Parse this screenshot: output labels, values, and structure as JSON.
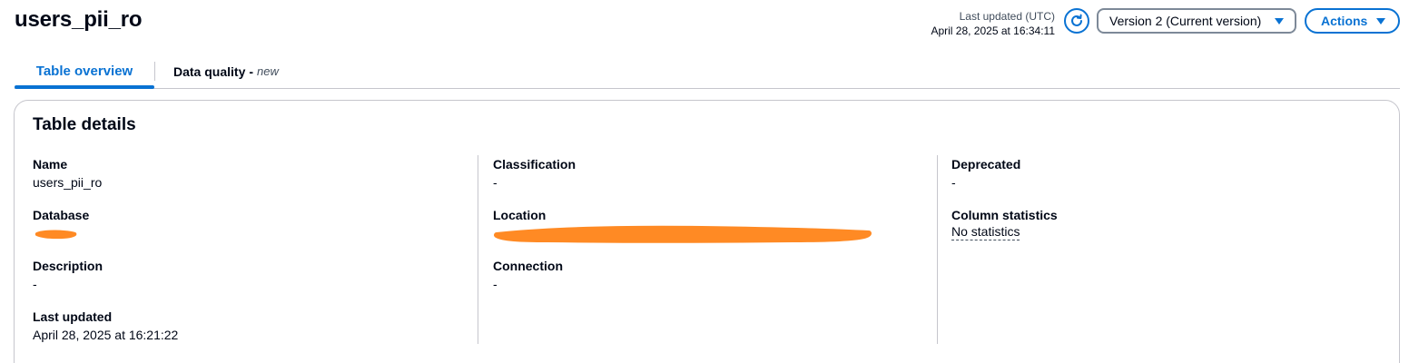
{
  "header": {
    "title": "users_pii_ro",
    "last_updated_label": "Last updated (UTC)",
    "last_updated_value": "April 28, 2025 at 16:34:11",
    "version_select": "Version 2 (Current version)",
    "actions_label": "Actions"
  },
  "tabs": [
    {
      "label": "Table overview",
      "active": true
    },
    {
      "label": "Data quality",
      "suffix": "new",
      "active": false
    }
  ],
  "tab_separator": "-",
  "details": {
    "title": "Table details",
    "name": {
      "label": "Name",
      "value": "users_pii_ro"
    },
    "database": {
      "label": "Database",
      "value": ""
    },
    "description": {
      "label": "Description",
      "value": "-"
    },
    "last_updated": {
      "label": "Last updated",
      "value": "April 28, 2025 at 16:21:22"
    },
    "classification": {
      "label": "Classification",
      "value": "-"
    },
    "location": {
      "label": "Location",
      "value": ""
    },
    "connection": {
      "label": "Connection",
      "value": "-"
    },
    "deprecated": {
      "label": "Deprecated",
      "value": "-"
    },
    "column_statistics": {
      "label": "Column statistics",
      "value": "No statistics"
    }
  },
  "colors": {
    "accent": "#0972d3",
    "redaction": "#ff8a24",
    "border": "#c6c6cd",
    "text": "#000716"
  }
}
